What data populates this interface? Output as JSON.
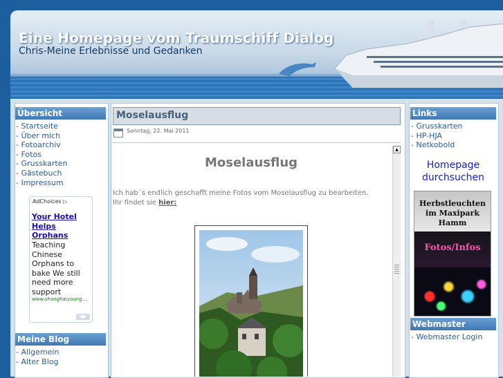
{
  "header": {
    "title": "Eine Homepage vom Traumschiff Dialog",
    "subtitle": "Chris-Meine Erlebnisse und Gedanken"
  },
  "left": {
    "overview_heading": "Übersicht",
    "nav": [
      "- Startseite",
      "- Über mich",
      "- Fotoarchiv",
      "- Fotos",
      "- Grusskarten",
      "- Gästebuch",
      "- Impressum"
    ],
    "ad": {
      "choices_label": "AdChoices",
      "title_lines": [
        "Your Hotel",
        "Helps",
        "Orphans"
      ],
      "text_lines": [
        "Teaching",
        "Chinese",
        "Orphans to",
        "bake We still",
        "need more",
        "support"
      ],
      "url": "www.shanghaiyoung..."
    },
    "blog_heading": "Meine Blog Themen",
    "blog_nav": [
      "- Allgemein",
      "- Alter Blog"
    ]
  },
  "main": {
    "post_title": "Moselausflug",
    "post_date": "Sonntag, 22. Mai 2011",
    "content_heading": "Moselausflug",
    "line1": "Ich hab`s endlich geschafft meine Fotos vom Moselausflug zu bearbeiten.",
    "line2_prefix": "Ihr findet sie ",
    "line2_link": "hier:"
  },
  "right": {
    "links_heading": "Links",
    "links": [
      "- Grusskarten",
      "- HP-HJA",
      "- Netkobold"
    ],
    "search_lines": [
      "Homepage",
      "durchsuchen"
    ],
    "banner": {
      "line1": "Herbstleuchten",
      "line2": "im Maxipark",
      "line3": "Hamm",
      "line4": "Fotos/Infos"
    },
    "webmaster_heading": "Webmaster",
    "webmaster_link": "- Webmaster Login"
  }
}
